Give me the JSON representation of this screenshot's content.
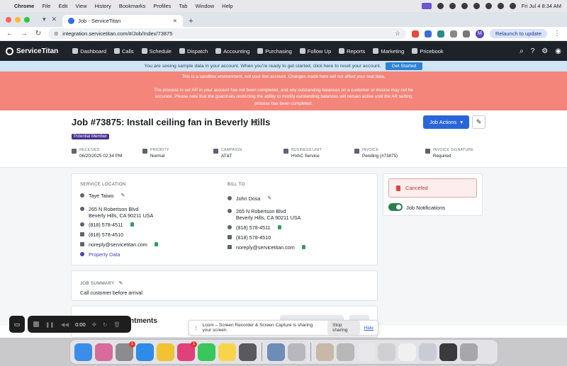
{
  "macos": {
    "app_name": "Chrome",
    "menus": [
      "File",
      "Edit",
      "View",
      "History",
      "Bookmarks",
      "Profiles",
      "Tab",
      "Window",
      "Help"
    ],
    "clock": "Fri Jul 4  8:34 AM"
  },
  "browser": {
    "tab_title": "Job - ServiceTitan",
    "url": "integration.servicetitan.com/#/Job/Index/73875",
    "profile_initial": "M",
    "relaunch_label": "Relaunch to update"
  },
  "app_nav": {
    "brand": "ServiceTitan",
    "items": [
      "Dashboard",
      "Calls",
      "Schedule",
      "Dispatch",
      "Accounting",
      "Purchasing",
      "Follow Up",
      "Reports",
      "Marketing",
      "Pricebook"
    ]
  },
  "banners": {
    "sample_text": "You are seeing sample data in your account. When you're ready to get started, click here to reset your account.",
    "get_started": "Get Started",
    "sandbox_text": "This is a sandbox environment, not your live account. Changes made here will not affect your real data.",
    "ar_text": "The process to set AR in your account has not been completed, and any outstanding balances on a customer or invoice may not be accurate. Please note that the guardrails restricting the ability to modify outstanding balances will remain active until the AR setting process has been completed."
  },
  "job": {
    "title": "Job #73875: Install ceiling fan in Beverly Hills",
    "badge": "Potential Member",
    "actions_label": "Job Actions",
    "meta": [
      {
        "label": "RECEIVED",
        "value": "06/20/2025 02:34 PM"
      },
      {
        "label": "PRIORITY",
        "value": "Normal"
      },
      {
        "label": "CAMPAIGN",
        "value": "AT&T"
      },
      {
        "label": "BUSINESS UNIT",
        "value": "HVAC Service"
      },
      {
        "label": "INVOICE",
        "value": "Pending (#73875)"
      },
      {
        "label": "INVOICE SIGNATURE",
        "value": "Required"
      }
    ]
  },
  "service_location": {
    "heading": "SERVICE LOCATION",
    "contact": "Taye Taiwo",
    "address_line1": "265 N Robertson Blvd",
    "address_line2": "Beverly Hills, CA 90211 USA",
    "phone": "(818) 578-4511",
    "fax": "(818) 578-4510",
    "email": "noreply@servicetitan.com",
    "property_link": "Property Data"
  },
  "bill_to": {
    "heading": "BILL TO",
    "contact": "John Dosa",
    "address_line1": "265 N Robertson Blvd",
    "address_line2": "Beverly Hills, CA 90211 USA",
    "phone": "(818) 578-4511",
    "fax": "(818) 578-4510",
    "email": "noreply@servicetitan.com"
  },
  "status": {
    "canceled": "Canceled",
    "notifications_label": "Job Notifications",
    "notifications_on": true
  },
  "job_summary": {
    "heading": "JOB SUMMARY",
    "text": "Call customer before arrival."
  },
  "appointments_heading_partial": "ntments",
  "recorder": {
    "time": "0:00"
  },
  "loom": {
    "message": "Loom – Screen Recorder & Screen Capture is sharing your screen.",
    "stop": "Stop sharing",
    "hide": "Hide"
  },
  "dock": {
    "mail_badge": "1",
    "slack_badge": "1"
  }
}
